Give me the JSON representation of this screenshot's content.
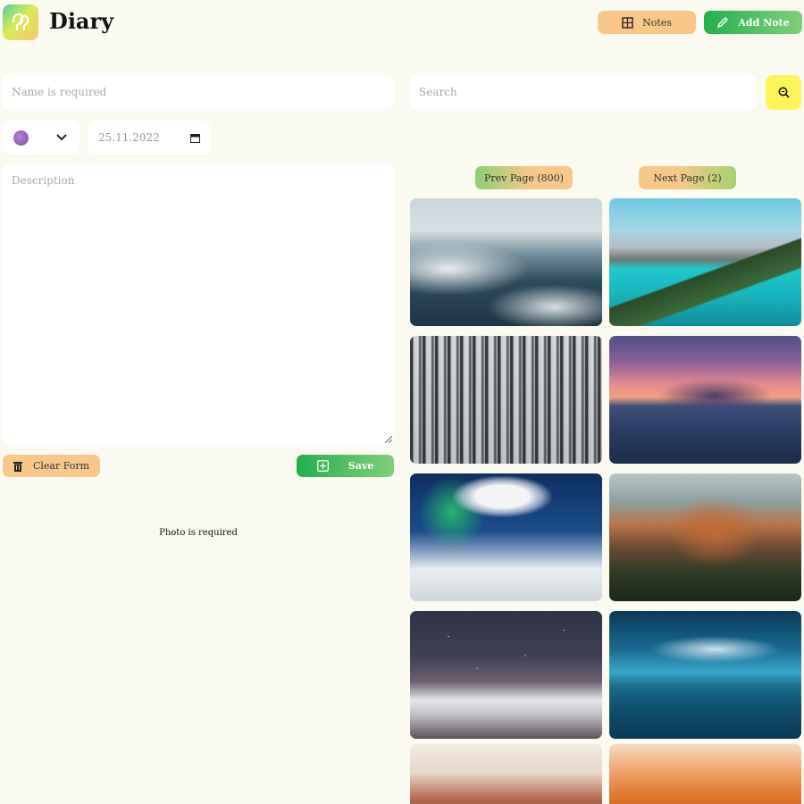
{
  "header": {
    "title": "Diary",
    "notes_label": "Notes",
    "add_note_label": "Add Note"
  },
  "form": {
    "name_placeholder": "Name is required",
    "emoji": "purple-circle",
    "date_value": "25.11.2022",
    "description_placeholder": "Description",
    "clear_label": "Clear Form",
    "save_label": "Save",
    "photo_message": "Photo is required"
  },
  "search": {
    "placeholder": "Search"
  },
  "pagination": {
    "prev_label": "Prev Page (800)",
    "next_label": "Next Page (2)"
  },
  "gallery": {
    "photos": [
      "foggy-forest",
      "turquoise-lake",
      "snowy-forest",
      "ocean-sunset",
      "aurora-over-snow",
      "mountain-canyon",
      "starry-snow-peaks",
      "island-at-dusk",
      "red-cliffs",
      "orange-desert"
    ]
  },
  "colors": {
    "background": "#fbfaf1",
    "orange_button": "#f9c889",
    "green_button": "#22b04d",
    "search_button": "#fff35a"
  }
}
